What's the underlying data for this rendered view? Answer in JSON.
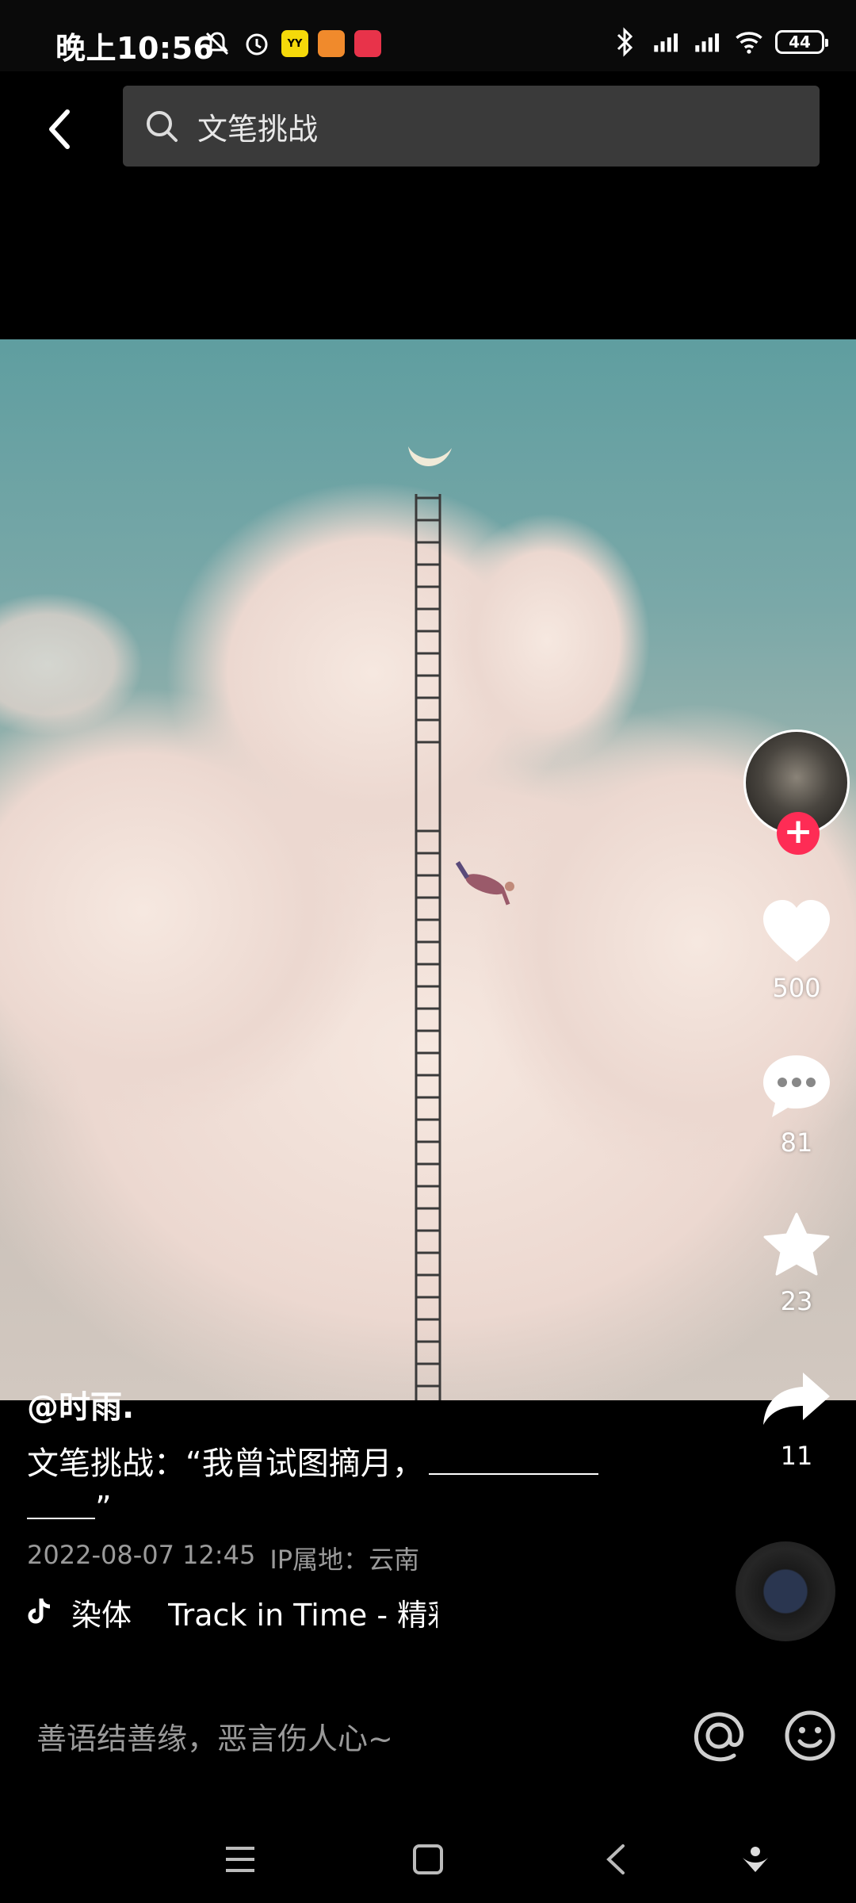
{
  "status_bar": {
    "time": "晚上10:56",
    "battery": "44",
    "app_badges": [
      {
        "icon": "yy-app-icon",
        "label": "YY",
        "color": "#f5d90a"
      },
      {
        "icon": "game-app-icon",
        "label": "",
        "color": "#f08a2c"
      },
      {
        "icon": "red-app-icon",
        "label": "",
        "color": "#e8334a"
      }
    ]
  },
  "header": {
    "search_text": "文笔挑战"
  },
  "rail": {
    "likes": "500",
    "comments": "81",
    "favorites": "23",
    "shares": "11"
  },
  "post": {
    "author": "@时雨.",
    "caption_line1": "文笔挑战：“我曾试图摘月，",
    "caption_line2": "”",
    "date": "2022-08-07 12:45",
    "ip_location": "IP属地：云南",
    "music_artist": "染体",
    "music_track": "Track in Time - 精彩"
  },
  "comment_bar": {
    "placeholder": "善语结善缘，恶言伤人心~"
  },
  "colors": {
    "follow": "#fe2c55",
    "search_bg": "#3a3a3a",
    "meta_text": "#9a9a9a"
  }
}
